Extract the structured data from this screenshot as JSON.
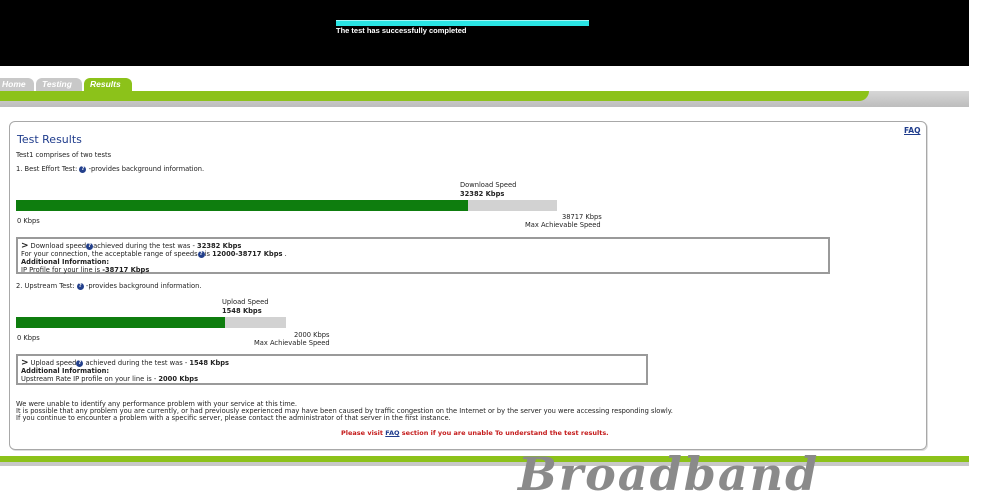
{
  "header": {
    "progress_percent": 100,
    "status_text": "The test has successfully completed"
  },
  "tabs": [
    {
      "label": "Home"
    },
    {
      "label": "Testing"
    },
    {
      "label": "Results"
    }
  ],
  "results": {
    "faq_link": "FAQ",
    "title": "Test Results",
    "intro": "Test1 comprises of two tests",
    "download": {
      "heading_prefix": "1. Best Effort Test:",
      "heading_suffix": "-provides background information.",
      "speed_label": "Download Speed",
      "speed_value": "32382 Kbps",
      "min_label": "0 Kbps",
      "max_value": "38717 Kbps",
      "max_label": "Max Achievable Speed",
      "achieved_kbps": 32382,
      "max_kbps": 38717,
      "box_line1_prefix": "Download speed",
      "box_line1_mid": "achieved during the test was - ",
      "box_line1_value": "32382 Kbps",
      "box_line2_prefix": "For your connection, the acceptable range of speeds",
      "box_line2_mid": "is ",
      "box_line2_value": "12000-38717 Kbps",
      "box_line2_suffix": " .",
      "box_line3": "Additional Information:",
      "box_line4_prefix": "IP Profile for your line is ",
      "box_line4_value": "-38717 Kbps"
    },
    "upload": {
      "heading_prefix": "2. Upstream Test:",
      "heading_suffix": "-provides background information.",
      "speed_label": "Upload Speed",
      "speed_value": "1548 Kbps",
      "min_label": "0 Kbps",
      "max_value": "2000 Kbps",
      "max_label": "Max Achievable Speed",
      "achieved_kbps": 1548,
      "max_kbps": 2000,
      "box_line1_prefix": "Upload speed",
      "box_line1_mid": " achieved during the test was - ",
      "box_line1_value": "1548 Kbps",
      "box_line2": "Additional Information:",
      "box_line3_prefix": "Upstream Rate IP profile on your line is - ",
      "box_line3_value": "2000 Kbps"
    },
    "summary_lines": [
      "We were unable to identify any performance problem with your service at this time.",
      "It is possible that any problem you are currently, or had previously experienced may have been caused by traffic congestion on the Internet or by the server you were accessing responding slowly.",
      "If you continue to encounter a problem with a specific server, please contact the administrator of that server in the first instance."
    ],
    "notice_prefix": "Please visit ",
    "notice_link": "FAQ",
    "notice_suffix": " section if you are unable To understand the test results."
  },
  "footer": {
    "brand": "Broadband"
  },
  "colors": {
    "accent_green": "#8cc21a",
    "bar_green": "#0e7d0e",
    "progress_cyan": "#29e4e4",
    "link_blue": "#1f3c8c",
    "notice_red": "#c41a1a"
  }
}
